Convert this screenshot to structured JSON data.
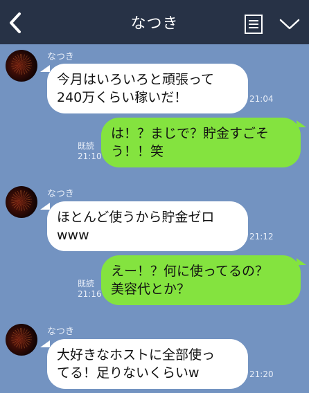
{
  "header": {
    "title": "なつき",
    "back_icon": "chevron-left-icon",
    "menu_icon": "list-icon",
    "more_icon": "chevron-down-icon"
  },
  "messages": [
    {
      "sender": "なつき",
      "text": "今月はいろいろと頑張って\n240万くらい稼いだ！",
      "time": "21:04"
    },
    {
      "text": "は！？まじで？貯金すごそ\nう！！笑",
      "read": "既読",
      "time": "21:10"
    },
    {
      "sender": "なつき",
      "text": "ほとんど使うから貯金ゼロ\nwww",
      "time": "21:12"
    },
    {
      "text": "えー！？何に使ってるの？\n美容代とか？",
      "read": "既読",
      "time": "21:16"
    },
    {
      "sender": "なつき",
      "text": "大好きなホストに全部使っ\nてる！足りないくらいw",
      "time": "21:20"
    }
  ],
  "colors": {
    "background": "#7393c1",
    "header": "#273246",
    "incoming_bubble": "#ffffff",
    "outgoing_bubble": "#84e33f"
  }
}
